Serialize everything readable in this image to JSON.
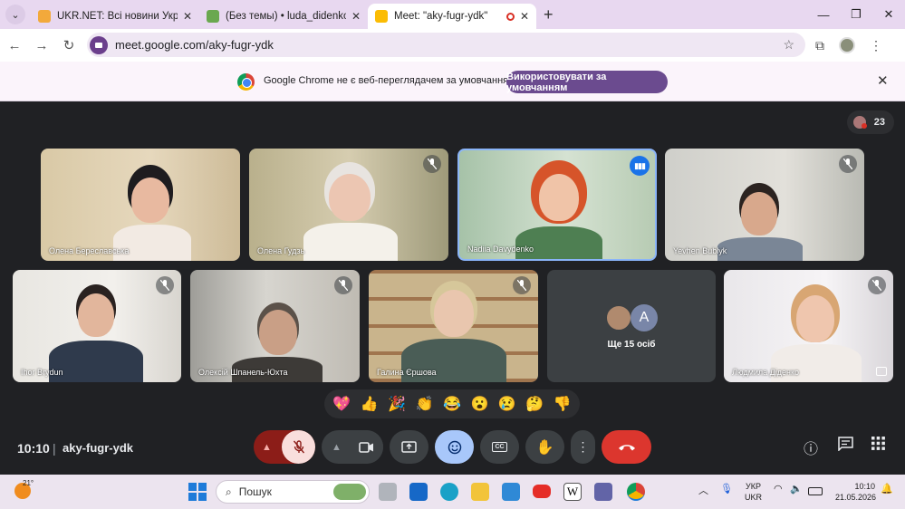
{
  "browser": {
    "tabs": [
      {
        "title": "UKR.NET: Всі новини України,",
        "favicon_color": "#f2a93b"
      },
      {
        "title": "(Без темы) • luda_didenko81@",
        "favicon_color": "#6aa84f"
      },
      {
        "title": "Meet: \"aky-fugr-ydk\"",
        "favicon_color": "#fbbc04"
      }
    ],
    "url": "meet.google.com/aky-fugr-ydk"
  },
  "infobar": {
    "message": "Google Chrome не є веб-переглядачем за умовчанням",
    "button": "Використовувати за умовчанням"
  },
  "meet": {
    "participant_count": "23",
    "participants": [
      {
        "name": "Олена Береславська",
        "muted": false,
        "speaking": false
      },
      {
        "name": "Олена Гудзь",
        "muted": true,
        "speaking": false
      },
      {
        "name": "Nadiia Davydenko",
        "muted": false,
        "speaking": true
      },
      {
        "name": "Yevhen Bublyk",
        "muted": true,
        "speaking": false
      },
      {
        "name": "Ihor Brydun",
        "muted": true,
        "speaking": false
      },
      {
        "name": "Олексій Шпанель-Юхта",
        "muted": true,
        "speaking": false
      },
      {
        "name": "Галина Єршова",
        "muted": true,
        "speaking": false
      },
      {
        "name": "Людмила Діденко",
        "muted": true,
        "speaking": false
      }
    ],
    "more": {
      "label": "Ще 15 осіб",
      "avatar_letter": "A"
    },
    "reactions": [
      "💖",
      "👍",
      "🎉",
      "👏",
      "😂",
      "😮",
      "😢",
      "🤔",
      "👎"
    ],
    "time": "10:10",
    "meeting_code": "aky-fugr-ydk"
  },
  "taskbar": {
    "temperature": "21°",
    "search_placeholder": "Пошук",
    "language": [
      "УКР",
      "UKR"
    ],
    "time": "10:10",
    "date": "21.05.2026"
  }
}
